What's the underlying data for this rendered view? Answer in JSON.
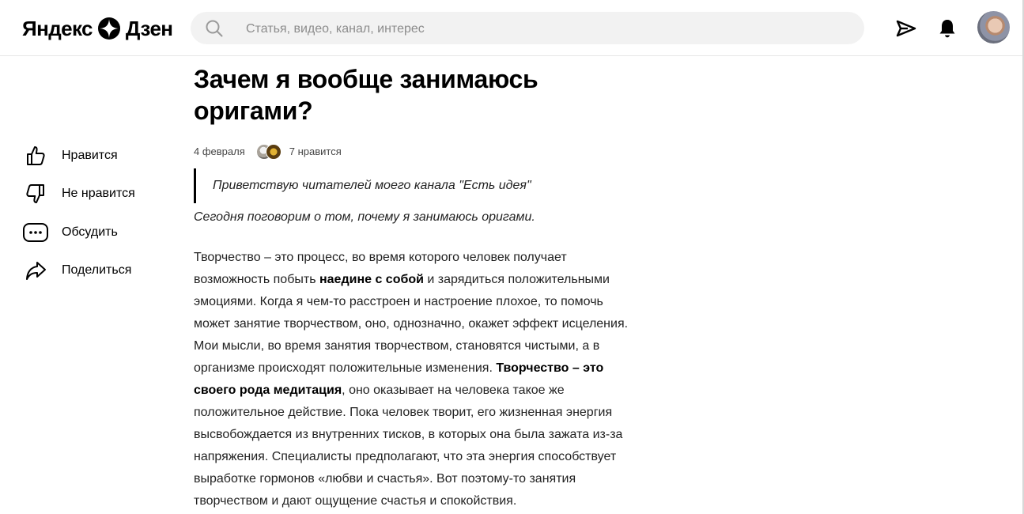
{
  "header": {
    "logo_text_left": "Яндекс",
    "logo_text_right": "Дзен",
    "search_placeholder": "Статья, видео, канал, интерес",
    "icons": [
      "search-icon",
      "send-icon",
      "bell-icon"
    ]
  },
  "actions": [
    {
      "label": "Нравится",
      "icon": "thumbs-up-icon"
    },
    {
      "label": "Не нравится",
      "icon": "thumbs-down-icon"
    },
    {
      "label": "Обсудить",
      "icon": "comment-icon"
    },
    {
      "label": "Поделиться",
      "icon": "share-icon"
    }
  ],
  "article": {
    "title_line1": "Зачем я вообще занимаюсь",
    "title_line2": "оригами?",
    "date": "4 февраля",
    "likes": "7 нравится",
    "quote": "Приветствую читателей моего канала \"Есть идея\"",
    "intro": "Сегодня поговорим о том, почему я занимаюсь оригами.",
    "body": {
      "l1": "Творчество – это процесс, во время которого человек получает",
      "l2a": "возможность побыть ",
      "l2b": "наедине с собой",
      "l2c": " и зарядиться положительными",
      "l3": "эмоциями. Когда я чем-то расстроен и настроение плохое, то помочь",
      "l4": "может занятие творчеством, оно, однозначно, окажет эффект исцеления.",
      "l5": "Мои мысли, во время занятия творчеством, становятся чистыми, а в",
      "l6a": "организме происходят положительные изменения. ",
      "l6b": "Творчество – это",
      "l7a": "своего рода медитация",
      "l7b": ", оно оказывает на человека такое же",
      "l8": "положительное действие. Пока человек творит, его жизненная энергия",
      "l9": "высвобождается из внутренних тисков, в которых она была зажата из-за",
      "l10": "напряжения. Специалисты предполагают, что эта энергия способствует",
      "l11": "выработке гормонов «любви и счастья». Вот поэтому-то занятия",
      "l12": "творчеством и дают ощущение счастья и спокойствия."
    }
  }
}
